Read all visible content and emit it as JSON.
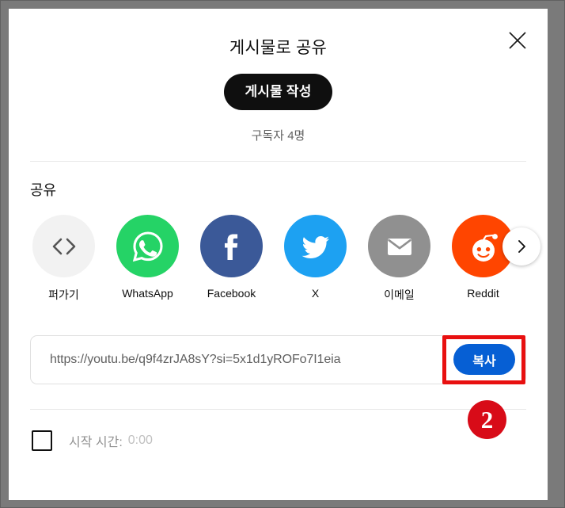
{
  "dialog": {
    "title": "게시물로 공유",
    "close_icon": "close-x-icon",
    "create_post_label": "게시물 작성",
    "subscriber_count": "구독자 4명"
  },
  "share": {
    "section_label": "공유",
    "next_icon": "chevron-right-icon",
    "targets": [
      {
        "name": "퍼가기",
        "icon": "embed-code-icon",
        "color": "#f2f2f2"
      },
      {
        "name": "WhatsApp",
        "icon": "whatsapp-icon",
        "color": "#25d366"
      },
      {
        "name": "Facebook",
        "icon": "facebook-icon",
        "color": "#3b5998"
      },
      {
        "name": "X",
        "icon": "twitter-bird-icon",
        "color": "#1da1f2"
      },
      {
        "name": "이메일",
        "icon": "email-icon",
        "color": "#909090"
      },
      {
        "name": "Reddit",
        "icon": "reddit-icon",
        "color": "#ff4500"
      }
    ]
  },
  "url_field": {
    "value": "https://youtu.be/q9f4zrJA8sY?si=5x1d1yROFo7I1eia",
    "copy_label": "복사",
    "copy_button_color": "#065fd4"
  },
  "annotation": {
    "step_number": "2",
    "highlight_color": "#e81010",
    "badge_color": "#d80b18"
  },
  "start_time": {
    "checked": false,
    "label": "시작 시간:",
    "value": "0:00"
  }
}
